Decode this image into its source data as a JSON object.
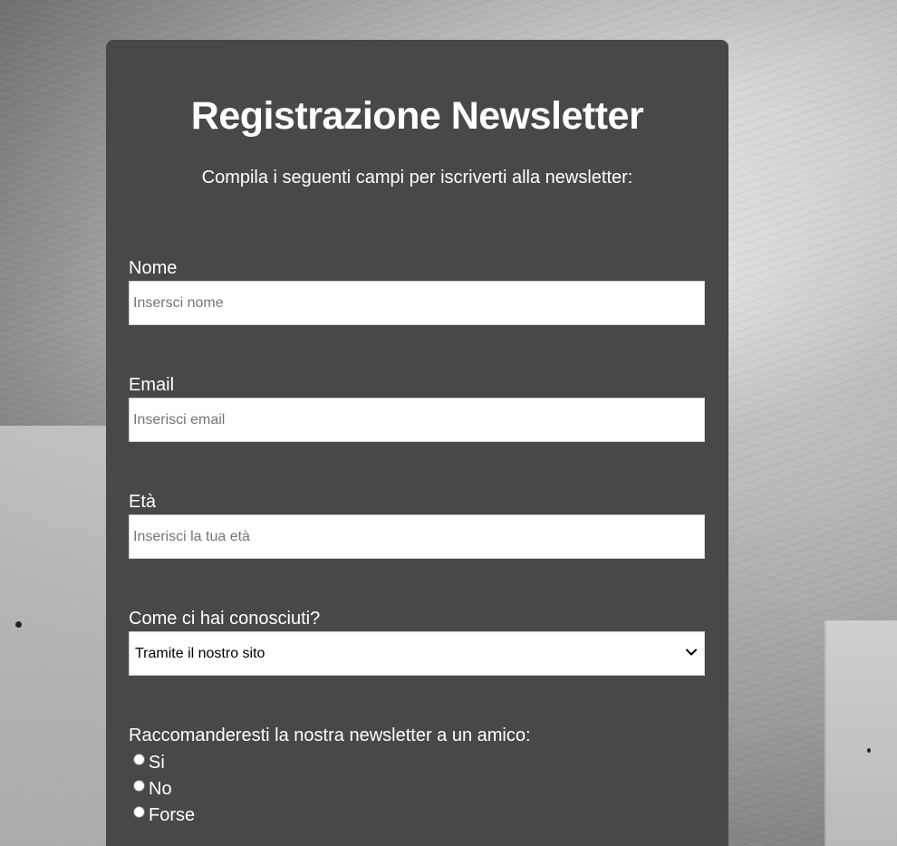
{
  "form": {
    "title": "Registrazione Newsletter",
    "subtitle": "Compila i seguenti campi per iscriverti alla newsletter:",
    "fields": {
      "nome": {
        "label": "Nome",
        "placeholder": "Insersci nome",
        "value": ""
      },
      "email": {
        "label": "Email",
        "placeholder": "Inserisci email",
        "value": ""
      },
      "eta": {
        "label": "Età",
        "placeholder": "Inserisci la tua età",
        "value": ""
      },
      "source": {
        "label": "Come ci hai conosciuti?",
        "selected": "Tramite il nostro sito"
      }
    },
    "recommend": {
      "label": "Raccomanderesti la nostra newsletter a un amico:",
      "options": [
        "Si",
        "No",
        "Forse"
      ],
      "selected": null
    }
  },
  "icons": {
    "select_arrow": "chevron-down-icon"
  },
  "colors": {
    "card_background": "#464946",
    "text": "#ffffff",
    "input_background": "#ffffff"
  }
}
